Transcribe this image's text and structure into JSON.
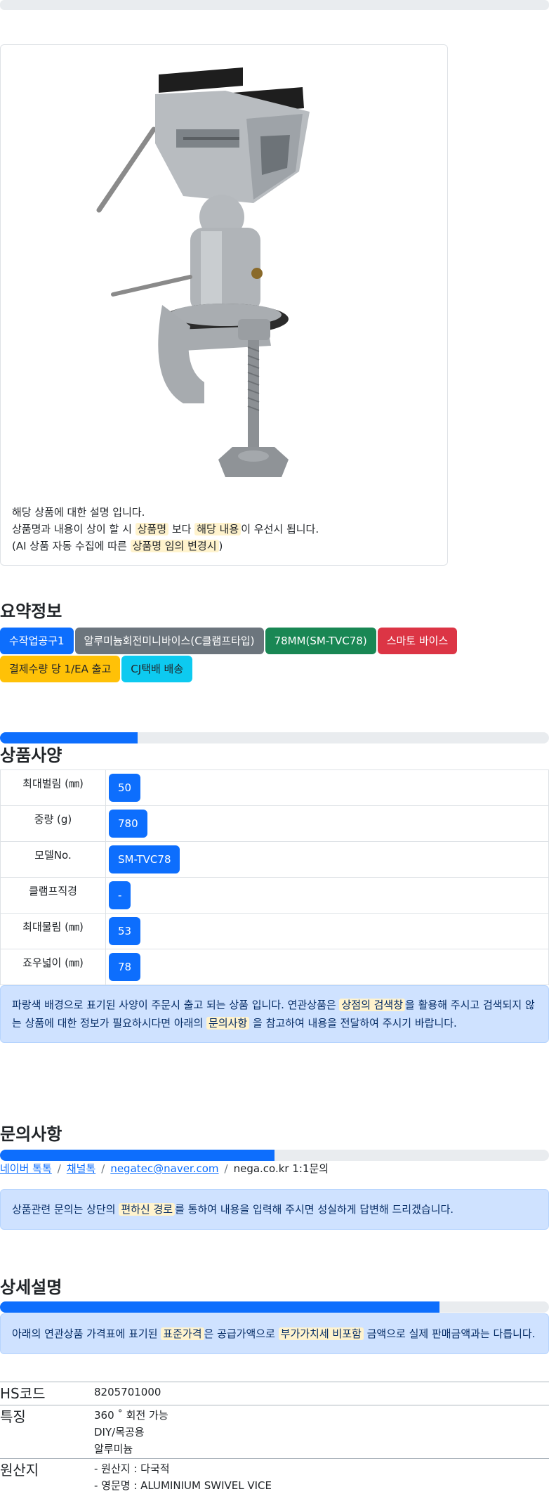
{
  "product": {
    "desc_line1": "해당 상품에 대한 설명 입니다.",
    "desc_line2_a": "상품명과 내용이 상이 할 시",
    "desc_line2_hl1": "상품명",
    "desc_line2_b": "보다",
    "desc_line2_hl2": "해당 내용",
    "desc_line2_c": "이 우선시 됩니다.",
    "desc_line3_a": "(AI 상품 자동 수집에 따른",
    "desc_line3_hl": "상품명 임의 변경시",
    "desc_line3_b": ")"
  },
  "summary": {
    "title": "요약정보",
    "badges": [
      "수작업공구1",
      "알루미늄회전미니바이스(C클램프타입)",
      "78MM(SM-TVC78)",
      "스마토 바이스",
      "결제수량 당 1/EA 출고",
      "CJ택배 배송"
    ]
  },
  "spec": {
    "title": "상품사양",
    "progress": 0.25,
    "rows": [
      {
        "key": "최대벌림 (㎜)",
        "value": "50"
      },
      {
        "key": "중량 (g)",
        "value": "780"
      },
      {
        "key": "모델No.",
        "value": "SM-TVC78"
      },
      {
        "key": "클램프직경",
        "value": "-"
      },
      {
        "key": "최대물림 (㎜)",
        "value": "53"
      },
      {
        "key": "죠우넓이 (㎜)",
        "value": "78"
      }
    ],
    "notice_a": "파랑색 배경으로 표기된 사양이 주문시 출고 되는 상품 입니다. 연관상품은",
    "notice_hl1": "상점의 검색창",
    "notice_b": "을 활용해 주시고 검색되지 않는 상품에 대한 정보가 필요하시다면 아래의",
    "notice_hl2": "문의사항",
    "notice_c": "을 참고하여 내용을 전달하여 주시기 바랍니다."
  },
  "inquiry": {
    "title": "문의사항",
    "progress": 0.5,
    "link1": "네이버 톡톡",
    "link2": "채널톡",
    "link3": "negatec@naver.com",
    "text4": "nega.co.kr 1:1문의",
    "notice_a": "상품관련 문의는 상단의",
    "notice_hl": "편하신 경로",
    "notice_b": "를 통하여 내용을 입력해 주시면 성실하게 답변해 드리겠습니다."
  },
  "detail": {
    "title": "상세설명",
    "progress": 0.8,
    "notice_a": "아래의 연관상품 가격표에 표기된",
    "notice_hl1": "표준가격",
    "notice_b": "은 공급가액으로",
    "notice_hl2": "부가가치세 비포함",
    "notice_c": "금액으로 실제 판매금액과는 다릅니다.",
    "hs_label": "HS코드",
    "hs_value": "8205701000",
    "feature_label": "특징",
    "features": [
      "360 ˚ 회전 가능",
      "DIY/목공용",
      "알루미늄"
    ],
    "origin_label": "원산지",
    "origins": [
      "- 원산지 : 다국적",
      "- 영문명 : ALUMINIUM SWIVEL VICE"
    ]
  }
}
